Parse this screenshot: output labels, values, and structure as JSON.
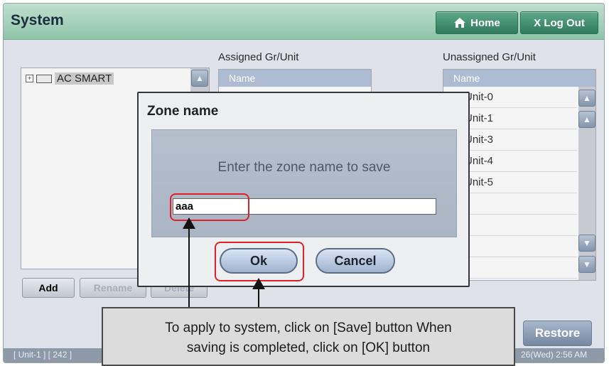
{
  "window": {
    "title": "System"
  },
  "topbar": {
    "home_label": "Home",
    "logout_label": "X Log Out"
  },
  "tree": {
    "root_label": "AC SMART",
    "expander": "+"
  },
  "assigned": {
    "header": "Assigned Gr/Unit",
    "column_name": "Name"
  },
  "unassigned": {
    "header": "Unassigned Gr/Unit",
    "column_name": "Name",
    "rows": [
      "Unit-0",
      "Unit-1",
      "Unit-3",
      "Unit-4",
      "Unit-5",
      "",
      "",
      "",
      ""
    ]
  },
  "buttons": {
    "add": "Add",
    "rename": "Rename",
    "delete": "Delete",
    "restore": "Restore"
  },
  "status": {
    "left": "[ Unit-1 ] [ 242 ]",
    "right": "26(Wed) 2:56 AM"
  },
  "dialog": {
    "title": "Zone name",
    "message": "Enter the zone name to save",
    "input_value": "aaa",
    "ok_label": "Ok",
    "cancel_label": "Cancel"
  },
  "callout": {
    "line1": "To apply to system, click on [Save] button When",
    "line2": "saving is completed, click on [OK] button"
  },
  "colors": {
    "highlight": "#e0212b",
    "titlebar": "#8fc4a9",
    "list_header": "#aebcd3"
  }
}
